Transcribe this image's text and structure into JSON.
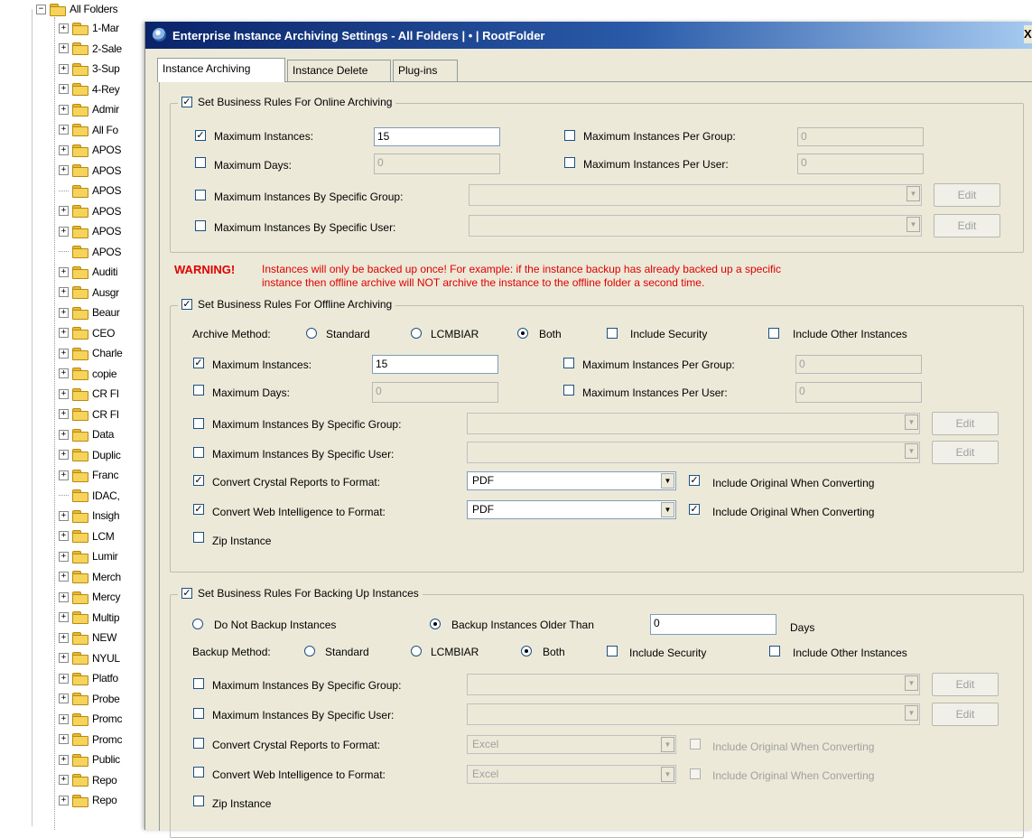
{
  "tree": {
    "root_label": "All Folders",
    "items": [
      {
        "label": "1-Mar",
        "expandable": true
      },
      {
        "label": "2-Sale",
        "expandable": true
      },
      {
        "label": "3-Sup",
        "expandable": true
      },
      {
        "label": "4-Rey",
        "expandable": true
      },
      {
        "label": "Admir",
        "expandable": true
      },
      {
        "label": "All Fo",
        "expandable": true
      },
      {
        "label": "APOS",
        "expandable": true
      },
      {
        "label": "APOS",
        "expandable": true
      },
      {
        "label": "APOS",
        "expandable": false
      },
      {
        "label": "APOS",
        "expandable": true
      },
      {
        "label": "APOS",
        "expandable": true
      },
      {
        "label": "APOS",
        "expandable": false
      },
      {
        "label": "Auditi",
        "expandable": true
      },
      {
        "label": "Ausgr",
        "expandable": true
      },
      {
        "label": "Beaur",
        "expandable": true
      },
      {
        "label": "CEO",
        "expandable": true
      },
      {
        "label": "Charle",
        "expandable": true
      },
      {
        "label": "copie",
        "expandable": true
      },
      {
        "label": "CR FI",
        "expandable": true
      },
      {
        "label": "CR FI",
        "expandable": true
      },
      {
        "label": "Data",
        "expandable": true
      },
      {
        "label": "Duplic",
        "expandable": true
      },
      {
        "label": "Franc",
        "expandable": true
      },
      {
        "label": "IDAC,",
        "expandable": false
      },
      {
        "label": "Insigh",
        "expandable": true
      },
      {
        "label": "LCM",
        "expandable": true
      },
      {
        "label": "Lumir",
        "expandable": true
      },
      {
        "label": "Merch",
        "expandable": true
      },
      {
        "label": "Mercy",
        "expandable": true
      },
      {
        "label": "Multip",
        "expandable": true
      },
      {
        "label": "NEW",
        "expandable": true
      },
      {
        "label": "NYUL",
        "expandable": true
      },
      {
        "label": "Platfo",
        "expandable": true
      },
      {
        "label": "Probe",
        "expandable": true
      },
      {
        "label": "Promc",
        "expandable": true
      },
      {
        "label": "Promc",
        "expandable": true
      },
      {
        "label": "Public",
        "expandable": true
      },
      {
        "label": "Repo",
        "expandable": true
      },
      {
        "label": "Repo",
        "expandable": true
      }
    ]
  },
  "dialog": {
    "title": "Enterprise Instance Archiving Settings - All Folders | • | RootFolder",
    "close_label": "X",
    "tabs": [
      {
        "label": "Instance Archiving",
        "active": true
      },
      {
        "label": "Instance Delete",
        "active": false
      },
      {
        "label": "Plug-ins",
        "active": false
      }
    ]
  },
  "online": {
    "legend": "Set Business Rules For Online Archiving",
    "checked": true,
    "max_instances_label": "Maximum Instances:",
    "max_instances_checked": true,
    "max_instances_value": "15",
    "max_days_label": "Maximum Days:",
    "max_days_checked": false,
    "max_days_value": "0",
    "per_group_label": "Maximum Instances Per Group:",
    "per_group_value": "0",
    "per_user_label": "Maximum Instances Per User:",
    "per_user_value": "0",
    "by_group_label": "Maximum Instances By Specific Group:",
    "by_user_label": "Maximum Instances By Specific User:",
    "edit_label": "Edit"
  },
  "warning": {
    "heading": "WARNING!",
    "line1": "Instances will only be backed up once! For example: if the instance backup has already backed up a specific",
    "line2": "instance then offline archive will NOT archive the instance to the offline folder a second time."
  },
  "offline": {
    "legend": "Set Business Rules For Offline Archiving",
    "checked": true,
    "archive_method_label": "Archive Method:",
    "method_standard": "Standard",
    "method_lcmbiar": "LCMBIAR",
    "method_both": "Both",
    "method_selected": "Both",
    "include_security": "Include Security",
    "include_other": "Include Other Instances",
    "max_instances_label": "Maximum Instances:",
    "max_instances_checked": true,
    "max_instances_value": "15",
    "max_days_label": "Maximum Days:",
    "max_days_value": "0",
    "per_group_label": "Maximum Instances Per Group:",
    "per_group_value": "0",
    "per_user_label": "Maximum Instances Per User:",
    "per_user_value": "0",
    "by_group_label": "Maximum Instances By Specific Group:",
    "by_user_label": "Maximum Instances By Specific User:",
    "edit_label": "Edit",
    "convert_cr_label": "Convert Crystal Reports to Format:",
    "convert_cr_checked": true,
    "convert_cr_value": "PDF",
    "convert_webi_label": "Convert Web Intelligence to Format:",
    "convert_webi_checked": true,
    "convert_webi_value": "PDF",
    "include_original": "Include Original When Converting",
    "zip_label": "Zip Instance"
  },
  "backup": {
    "legend": "Set Business Rules For Backing Up Instances",
    "checked": true,
    "do_not_backup": "Do Not Backup Instances",
    "backup_older": "Backup Instances Older Than",
    "days_value": "0",
    "days_label": "Days",
    "backup_method_label": "Backup Method:",
    "method_standard": "Standard",
    "method_lcmbiar": "LCMBIAR",
    "method_both": "Both",
    "include_security": "Include Security",
    "include_other": "Include Other Instances",
    "by_group_label": "Maximum Instances By Specific Group:",
    "by_user_label": "Maximum Instances By Specific User:",
    "edit_label": "Edit",
    "convert_cr_label": "Convert Crystal Reports to Format:",
    "convert_cr_value": "Excel",
    "convert_webi_label": "Convert Web Intelligence to Format:",
    "convert_webi_value": "Excel",
    "include_original": "Include Original When Converting",
    "zip_label": "Zip Instance"
  },
  "colors": {
    "title_gradient_start": "#0a246a",
    "title_gradient_end": "#a6caf0",
    "dialog_bg": "#ece9d8",
    "warning": "#e00000"
  }
}
